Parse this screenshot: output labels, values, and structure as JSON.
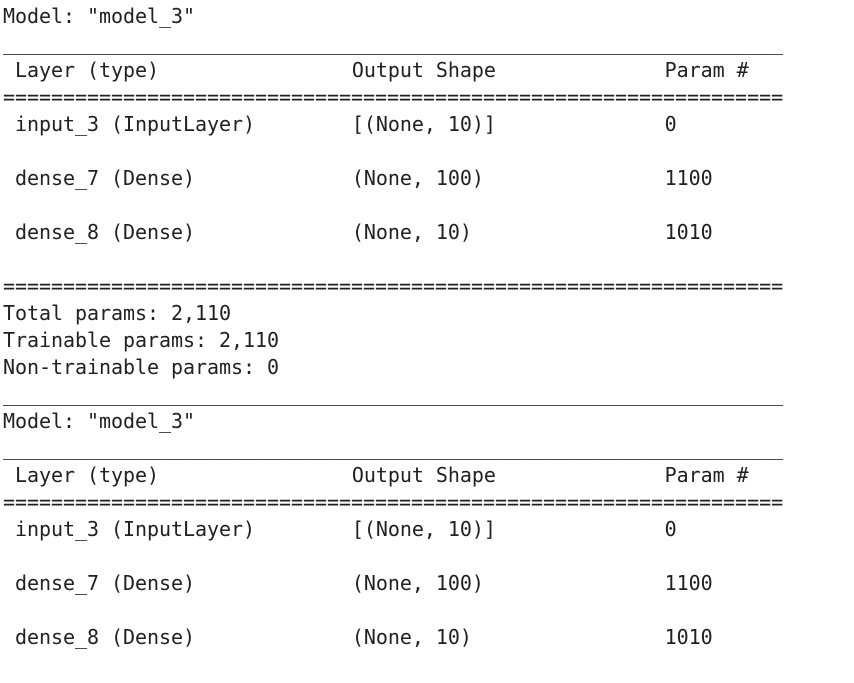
{
  "separators": {
    "underscore": "_________________________________________________________________",
    "equals": "================================================================="
  },
  "summaries": [
    {
      "model_label": "Model: \"model_3\"",
      "headers": [
        "Layer (type)",
        "Output Shape",
        "Param #"
      ],
      "rows": [
        [
          "input_3 (InputLayer)",
          "[(None, 10)]",
          "0"
        ],
        [
          "dense_7 (Dense)",
          "(None, 100)",
          "1100"
        ],
        [
          "dense_8 (Dense)",
          "(None, 10)",
          "1010"
        ]
      ],
      "totals": [
        "Total params: 2,110",
        "Trainable params: 2,110",
        "Non-trainable params: 0"
      ]
    },
    {
      "model_label": "Model: \"model_3\"",
      "headers": [
        "Layer (type)",
        "Output Shape",
        "Param #"
      ],
      "rows": [
        [
          "input_3 (InputLayer)",
          "[(None, 10)]",
          "0"
        ],
        [
          "dense_7 (Dense)",
          "(None, 100)",
          "1100"
        ],
        [
          "dense_8 (Dense)",
          "(None, 10)",
          "1010"
        ]
      ]
    }
  ]
}
